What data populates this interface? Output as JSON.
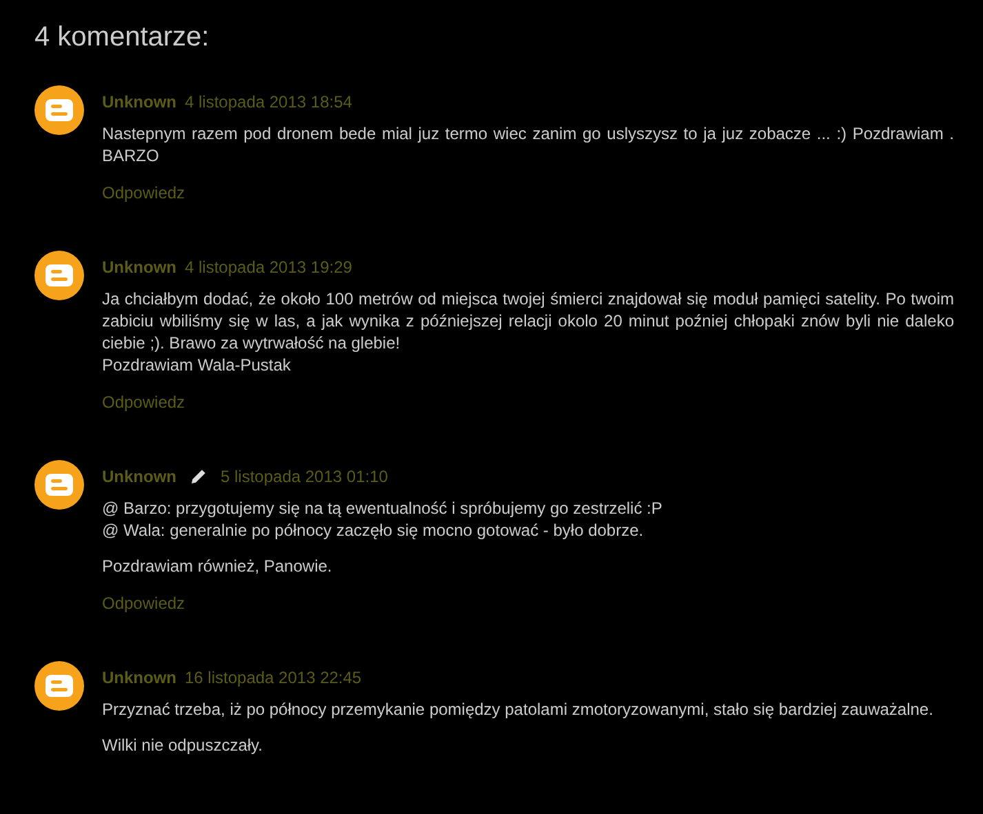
{
  "heading": "4 komentarze:",
  "comments": [
    {
      "author": "Unknown",
      "edited": false,
      "date": "4 listopada 2013 18:54",
      "paragraphs": [
        [
          "Nastepnym razem pod dronem bede mial juz termo wiec zanim go uslyszysz to ja juz zobacze ... :) Pozdrawiam . BARZO"
        ]
      ],
      "reply": "Odpowiedz"
    },
    {
      "author": "Unknown",
      "edited": false,
      "date": "4 listopada 2013 19:29",
      "paragraphs": [
        [
          "Ja chciałbym dodać, że około 100 metrów od miejsca twojej śmierci znajdował się moduł pamięci satelity. Po twoim zabiciu wbiliśmy się w las, a jak wynika z późniejszej relacji okolo 20 minut poźniej chłopaki znów byli nie daleko ciebie ;). Brawo za wytrwałość na glebie!",
          "Pozdrawiam Wala-Pustak"
        ]
      ],
      "reply": "Odpowiedz"
    },
    {
      "author": "Unknown",
      "edited": true,
      "date": "5 listopada 2013 01:10",
      "paragraphs": [
        [
          "@ Barzo: przygotujemy się na tą ewentualność i spróbujemy go zestrzelić :P",
          "@ Wala: generalnie po północy zaczęło się mocno gotować - było dobrze."
        ],
        [
          "Pozdrawiam również, Panowie."
        ]
      ],
      "reply": "Odpowiedz"
    },
    {
      "author": "Unknown",
      "edited": false,
      "date": "16 listopada 2013 22:45",
      "paragraphs": [
        [
          "Przyznać trzeba, iż po północy przemykanie pomiędzy patolami zmotoryzowanymi, stało się bardziej zauważalne."
        ],
        [
          "Wilki nie odpuszczały."
        ]
      ]
    }
  ]
}
